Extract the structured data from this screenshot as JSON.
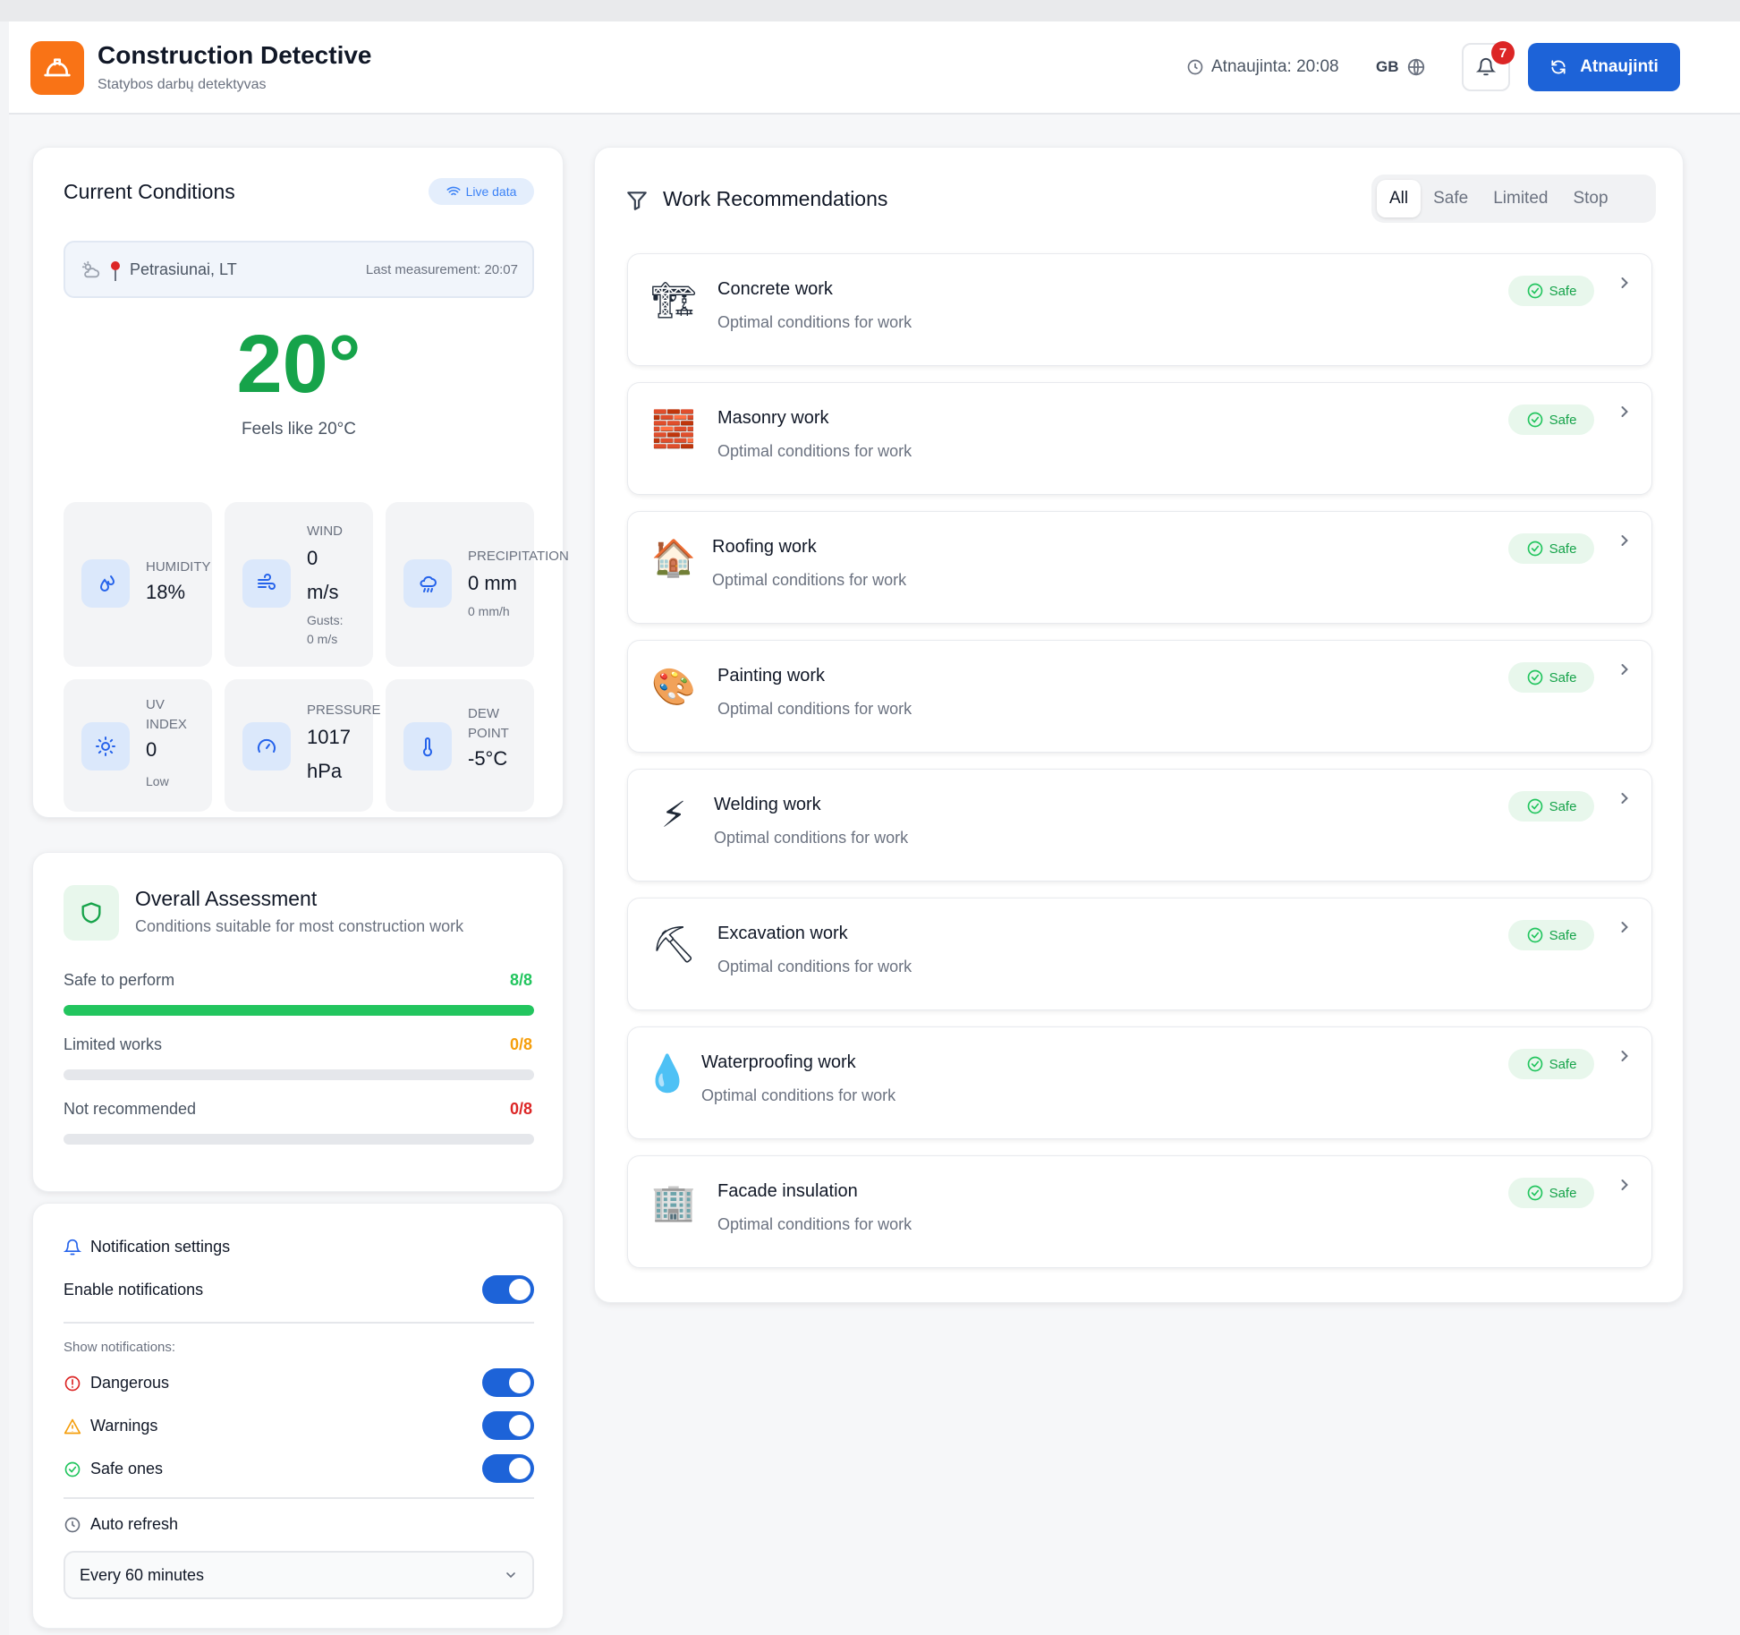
{
  "header": {
    "title": "Construction Detective",
    "subtitle": "Statybos darbų detektyvas",
    "updated": "Atnaujinta: 20:08",
    "language": "GB",
    "notification_count": "7",
    "refresh_label": "Atnaujinti"
  },
  "conditions": {
    "title": "Current Conditions",
    "live_label": "Live data",
    "location": "Petrasiunai, LT",
    "last_measurement": "Last measurement: 20:07",
    "temperature": "20°",
    "feels_like": "Feels like 20°C",
    "tiles": {
      "humidity": {
        "label": "HUMIDITY",
        "value": "18%"
      },
      "wind": {
        "label": "WIND",
        "value_line1": "0",
        "value_line2": "m/s",
        "sub_line1": "Gusts:",
        "sub_line2": "0 m/s"
      },
      "precipitation": {
        "label": "PRECIPITATION",
        "value": "0 mm",
        "sub": "0 mm/h"
      },
      "uv": {
        "label_line1": "UV",
        "label_line2": "INDEX",
        "value": "0",
        "sub": "Low"
      },
      "pressure": {
        "label": "PRESSURE",
        "value_line1": "1017",
        "value_line2": "hPa"
      },
      "dew": {
        "label_line1": "DEW",
        "label_line2": "POINT",
        "value": "-5°C"
      }
    }
  },
  "assessment": {
    "title": "Overall Assessment",
    "subtitle": "Conditions suitable for most construction work",
    "stats": [
      {
        "label": "Safe to perform",
        "value": "8/8",
        "fraction": 1.0,
        "color": "#22c55e"
      },
      {
        "label": "Limited works",
        "value": "0/8",
        "fraction": 0.0,
        "color": "#f59e0b"
      },
      {
        "label": "Not recommended",
        "value": "0/8",
        "fraction": 0.0,
        "color": "#dc2626"
      }
    ]
  },
  "notifications": {
    "title": "Notification settings",
    "enable_label": "Enable notifications",
    "show_label": "Show notifications:",
    "dangerous_label": "Dangerous",
    "warnings_label": "Warnings",
    "safe_label": "Safe ones",
    "auto_refresh_label": "Auto refresh",
    "auto_refresh_value": "Every 60 minutes"
  },
  "recommendations": {
    "title": "Work Recommendations",
    "filters": [
      "All",
      "Safe",
      "Limited",
      "Stop"
    ],
    "items": [
      {
        "title": "Concrete work",
        "desc": "Optimal conditions for work",
        "status": "Safe",
        "icon": "🏗"
      },
      {
        "title": "Masonry work",
        "desc": "Optimal conditions for work",
        "status": "Safe",
        "icon": "🧱"
      },
      {
        "title": "Roofing work",
        "desc": "Optimal conditions for work",
        "status": "Safe",
        "icon": "🏠"
      },
      {
        "title": "Painting work",
        "desc": "Optimal conditions for work",
        "status": "Safe",
        "icon": "🎨"
      },
      {
        "title": "Welding work",
        "desc": "Optimal conditions for work",
        "status": "Safe",
        "icon": "⚡"
      },
      {
        "title": "Excavation work",
        "desc": "Optimal conditions for work",
        "status": "Safe",
        "icon": "⛏"
      },
      {
        "title": "Waterproofing work",
        "desc": "Optimal conditions for work",
        "status": "Safe",
        "icon": "💧"
      },
      {
        "title": "Facade insulation",
        "desc": "Optimal conditions for work",
        "status": "Safe",
        "icon": "🏢"
      }
    ]
  }
}
